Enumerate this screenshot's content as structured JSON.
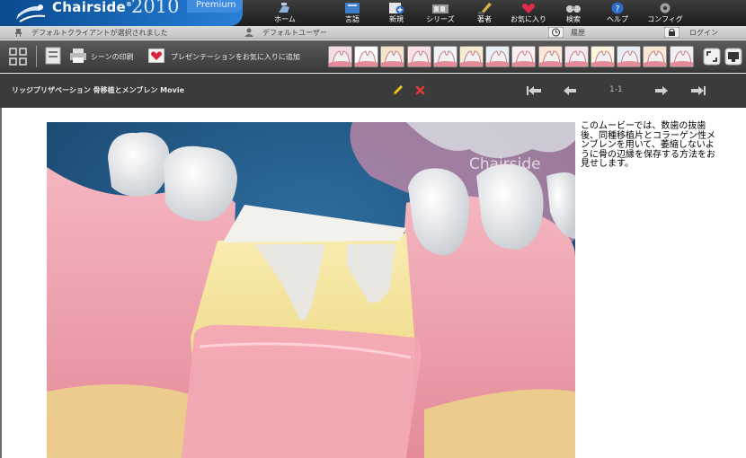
{
  "app": {
    "brand": "Chairside",
    "brand_mark": "®",
    "year": "2010",
    "edition": "Premium"
  },
  "nav": [
    {
      "label": "ホーム",
      "icon": "home-chair-icon"
    },
    {
      "label": "言語",
      "icon": "language-book-icon"
    },
    {
      "label": "新規",
      "icon": "new-document-icon"
    },
    {
      "label": "シリーズ",
      "icon": "series-film-icon"
    },
    {
      "label": "著者",
      "icon": "author-pen-icon"
    },
    {
      "label": "お気に入り",
      "icon": "favorites-heart-icon"
    },
    {
      "label": "検索",
      "icon": "search-binoculars-icon"
    },
    {
      "label": "ヘルプ",
      "icon": "help-question-icon"
    },
    {
      "label": "コンフィグ",
      "icon": "config-gear-icon"
    }
  ],
  "status": {
    "client": "デフォルトクライアントが選択されました",
    "user": "デフォルトユーザー",
    "history": "履歴",
    "login": "ログイン"
  },
  "toolbar": {
    "print_scene": "シーンの印刷",
    "add_favorite": "プレゼンテーションをお気に入りに追加",
    "thumbnails": [
      "extraction-thumb",
      "crown-thumb",
      "bridge-thumb",
      "implant-thumb",
      "dentures-thumb",
      "root-canal-thumb",
      "braces-thumb",
      "veneers-thumb",
      "periodontal-thumb",
      "gum-graft-thumb",
      "whitening-thumb",
      "bone-graft-thumb",
      "sealant-thumb",
      "xray-thumb"
    ]
  },
  "presentation": {
    "title": "リッジプリザベーション 骨移植とメンブレン Movie",
    "page": "1-1",
    "watermark": "Chairside",
    "description": "このムービーでは、数歯の抜歯後、同種移植片とコラーゲン性メンブレンを用いて、萎縮しないように骨の辺縁を保存する方法をお見せします。"
  },
  "colors": {
    "brand_blue": "#1d6fc4",
    "toolbar_dark": "#3b3b3b",
    "edit_pencil": "#f0c419",
    "delete_x": "#e53935"
  }
}
